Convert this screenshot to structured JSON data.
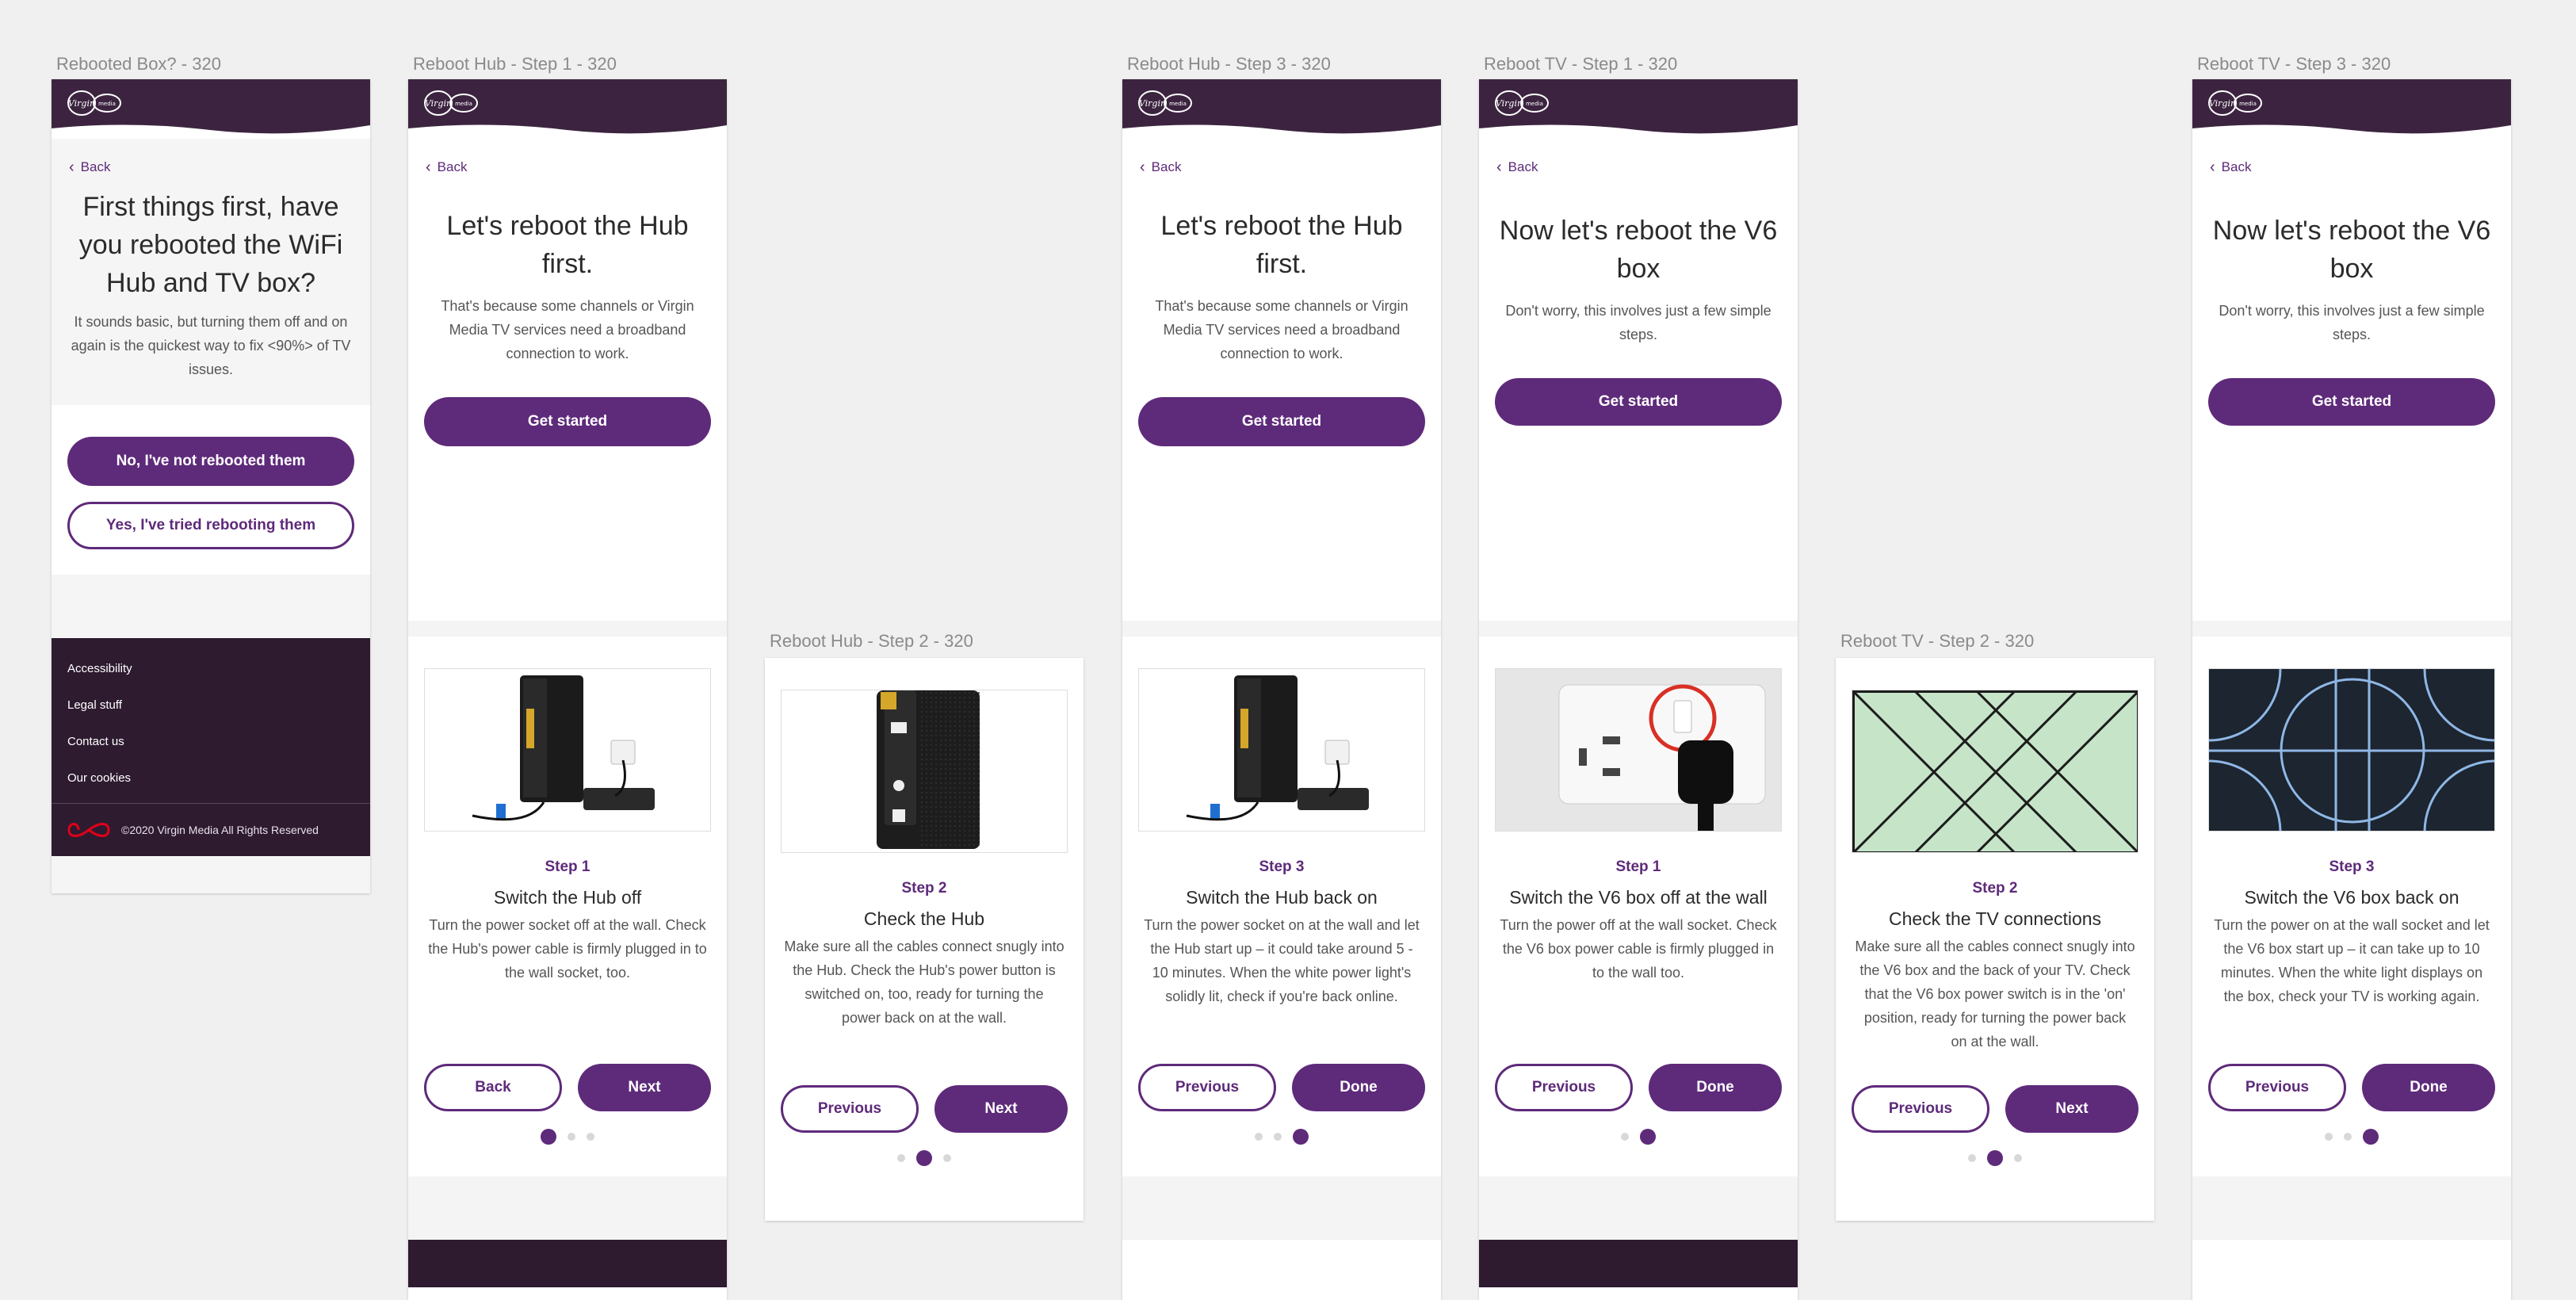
{
  "labels": {
    "a1": "Rebooted Box? - 320",
    "a2": "Reboot Hub - Step 1 - 320",
    "a3": "Reboot Hub  - Step 2 - 320",
    "a4": "Reboot Hub - Step 3 - 320",
    "a5": "Reboot TV - Step 1 - 320",
    "a6": "Reboot TV  - Step 2 - 320",
    "a7": "Reboot TV - Step 3 - 320"
  },
  "back": "Back",
  "rebooted": {
    "title": "First things first, have you rebooted the WiFi Hub and TV box?",
    "body": "It sounds basic, but turning them off and on again is the quickest way to fix <90%> of TV issues.",
    "no_btn": "No, I've not rebooted them",
    "yes_btn": "Yes, I've tried rebooting them",
    "footer_links": [
      "Accessibility",
      "Legal stuff",
      "Contact us",
      "Our cookies"
    ],
    "copyright": "©2020 Virgin Media  All Rights Reserved"
  },
  "hub": {
    "title": "Let's reboot the Hub first.",
    "body": "That's because some channels or Virgin Media TV services need a broadband connection to work.",
    "start": "Get started",
    "step1": {
      "num": "Step 1",
      "title": "Switch the Hub off",
      "desc": "Turn the power socket off at the wall. Check the Hub's power cable is firmly plugged in to the wall socket, too."
    },
    "step2": {
      "num": "Step 2",
      "title": "Check the Hub",
      "desc": "Make sure all the cables connect snugly into the Hub. Check the Hub's power button is switched on, too, ready for turning the power back on at the wall."
    },
    "step3": {
      "num": "Step 3",
      "title": "Switch the Hub back on",
      "desc": "Turn the power socket on at the wall and let the Hub start up – it could take around 5 - 10 minutes. When the white power light's solidly lit, check if you're back online."
    }
  },
  "tv": {
    "title": "Now let's reboot the V6 box",
    "body": "Don't worry, this involves just a few simple steps.",
    "start": "Get started",
    "step1": {
      "num": "Step 1",
      "title": "Switch the V6 box off at the wall",
      "desc": "Turn the power off at the wall socket. Check the V6 box power cable is firmly plugged in to the wall too."
    },
    "step2": {
      "num": "Step 2",
      "title": "Check the TV connections",
      "desc": "Make sure all the cables connect snugly into the V6 box and the back of your TV. Check that the V6 box power switch is in the 'on' position, ready for turning the power back on at the wall."
    },
    "step3": {
      "num": "Step 3",
      "title": "Switch the V6 box back on",
      "desc": "Turn the power on at the wall socket and let the V6 box start up – it can take up to 10 minutes. When the white light displays on the box, check your TV is working again."
    }
  },
  "nav": {
    "back": "Back",
    "next": "Next",
    "previous": "Previous",
    "done": "Done"
  },
  "colors": {
    "brand_purple": "#5e2a7a",
    "header": "#2e1b30",
    "logo_red": "#e1001a"
  },
  "carousel": {
    "hub_step1_active": 1,
    "hub_step2_active": 2,
    "hub_step3_active": 3,
    "tv_step1_active": 2,
    "tv_step2_active": 2,
    "tv_step3_active": 3
  }
}
